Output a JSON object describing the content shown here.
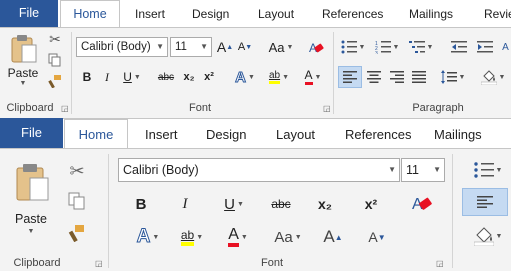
{
  "top": {
    "tabs": {
      "file": "File",
      "home": "Home",
      "insert": "Insert",
      "design": "Design",
      "layout": "Layout",
      "references": "References",
      "mailings": "Mailings",
      "review": "Revie"
    },
    "clipboard": {
      "paste": "Paste",
      "label": "Clipboard"
    },
    "font": {
      "name": "Calibri (Body)",
      "size": "11",
      "grow": "A",
      "shrink": "A",
      "case": "Aa",
      "bold": "B",
      "italic": "I",
      "underline": "U",
      "strike": "abc",
      "sub": "x₂",
      "sup": "x²",
      "effects": "A",
      "highlight": "ab",
      "color": "A",
      "label": "Font"
    },
    "paragraph": {
      "label": "Paragraph"
    }
  },
  "bottom": {
    "tabs": {
      "file": "File",
      "home": "Home",
      "insert": "Insert",
      "design": "Design",
      "layout": "Layout",
      "references": "References",
      "mailings": "Mailings"
    },
    "clipboard": {
      "paste": "Paste",
      "label": "Clipboard"
    },
    "font": {
      "name": "Calibri (Body)",
      "size": "11",
      "bold": "B",
      "italic": "I",
      "underline": "U",
      "strike": "abc",
      "sub": "x₂",
      "sup": "x²",
      "effects": "A",
      "highlight": "ab",
      "color": "A",
      "case": "Aa",
      "grow": "A",
      "shrink": "A",
      "label": "Font"
    }
  },
  "colors": {
    "brand": "#2b579a",
    "highlight": "#ffff00",
    "font_color": "#e81123",
    "selected": "#c5daf2"
  }
}
